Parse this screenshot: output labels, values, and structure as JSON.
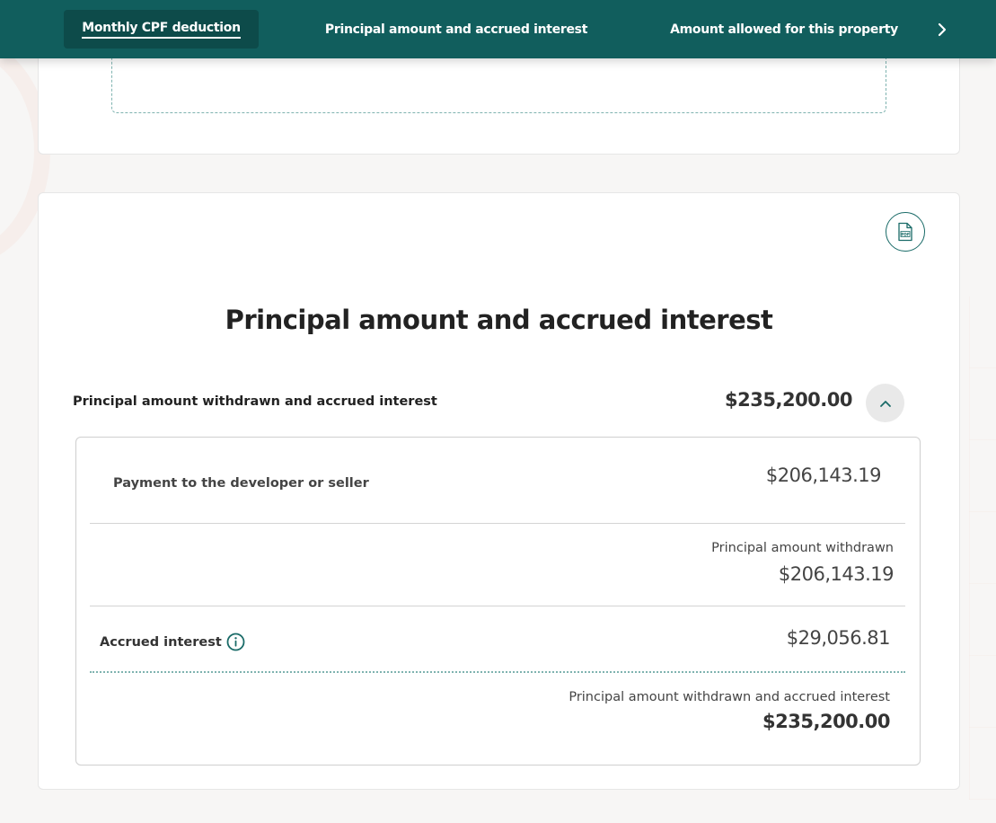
{
  "nav": {
    "tabs": [
      {
        "label": "Monthly CPF deduction",
        "active": true
      },
      {
        "label": "Principal amount and accrued interest",
        "active": false
      },
      {
        "label": "Amount allowed for this property",
        "active": false
      }
    ],
    "next_icon": "chevron-right-icon"
  },
  "section": {
    "title": "Principal amount and accrued interest",
    "pdf_icon": "pdf-file-icon"
  },
  "summary": {
    "label": "Principal amount withdrawn and accrued interest",
    "amount": "$235,200.00",
    "collapse_icon": "chevron-up-icon"
  },
  "breakdown": {
    "payee_label": "Payment to the developer or seller",
    "payee_amount": "$206,143.19",
    "principal_label": "Principal amount withdrawn",
    "principal_amount": "$206,143.19",
    "interest_label": "Accrued interest",
    "interest_info_icon": "info-icon",
    "interest_amount": "$29,056.81",
    "total_label": "Principal amount withdrawn and accrued interest",
    "total_amount": "$235,200.00"
  },
  "colors": {
    "brand": "#115e5d",
    "brand_dark": "#0d4b4a",
    "accent_dotted": "#7fb3b0"
  }
}
